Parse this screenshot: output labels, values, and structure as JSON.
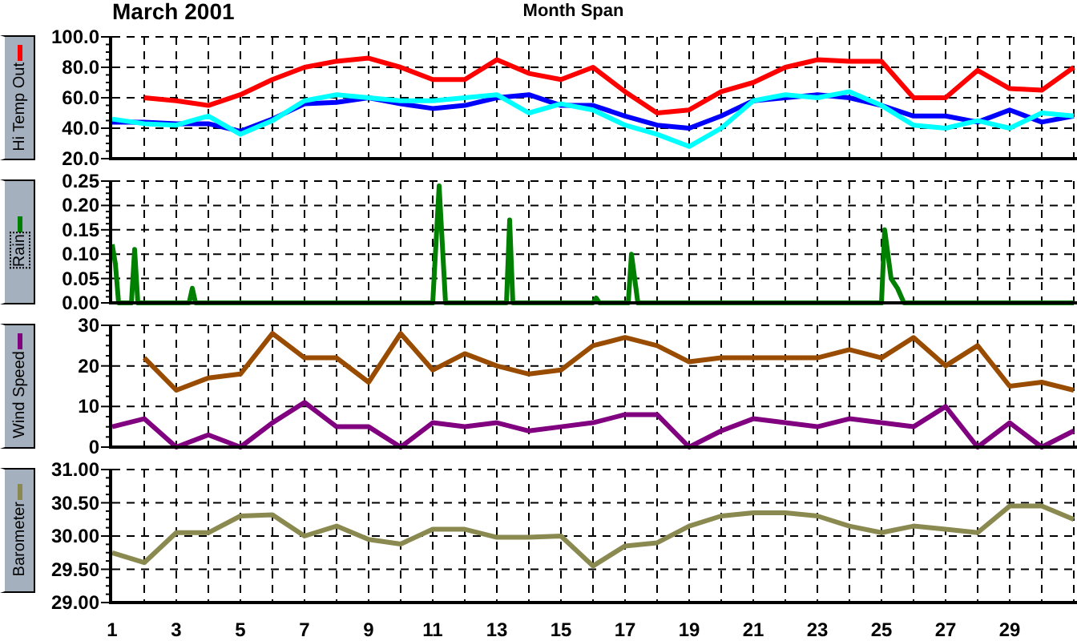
{
  "title": "March 2001",
  "span_label": "Month Span",
  "panels": [
    {
      "button": {
        "label": "Hi Temp Out",
        "color": "#ff0000",
        "focused": false
      },
      "chart_data": {
        "type": "line",
        "grid": true,
        "x": [
          1,
          2,
          3,
          4,
          5,
          6,
          7,
          8,
          9,
          10,
          11,
          12,
          13,
          14,
          15,
          16,
          17,
          18,
          19,
          20,
          21,
          22,
          23,
          24,
          25,
          26,
          27,
          28,
          29,
          30,
          31
        ],
        "xlim": [
          1,
          31
        ],
        "ylim": [
          20,
          100
        ],
        "yticks": [
          {
            "value": 20,
            "label": "20.0"
          },
          {
            "value": 40,
            "label": "40.0"
          },
          {
            "value": 60,
            "label": "60.0"
          },
          {
            "value": 80,
            "label": "80.0"
          },
          {
            "value": 100,
            "label": "100.0"
          }
        ],
        "series": [
          {
            "color": "#ff0000",
            "values": [
              null,
              60,
              58,
              55,
              62,
              72,
              80,
              84,
              86,
              80,
              72,
              72,
              85,
              76,
              72,
              80,
              64,
              50,
              52,
              64,
              70,
              80,
              85,
              84,
              84,
              60,
              60,
              78,
              66,
              65,
              80
            ]
          },
          {
            "color": "#0000ff",
            "values": [
              44,
              44,
              43,
              43,
              38,
              46,
              56,
              57,
              60,
              56,
              53,
              55,
              60,
              62,
              55,
              55,
              48,
              42,
              40,
              48,
              58,
              60,
              62,
              60,
              55,
              48,
              48,
              44,
              52,
              44,
              48
            ]
          },
          {
            "color": "#00ffff",
            "values": [
              46,
              43,
              42,
              48,
              36,
              45,
              58,
              62,
              60,
              58,
              58,
              60,
              62,
              50,
              56,
              52,
              42,
              36,
              28,
              40,
              58,
              62,
              60,
              64,
              55,
              42,
              40,
              45,
              40,
              50,
              48
            ]
          }
        ]
      }
    },
    {
      "button": {
        "label": "Rain",
        "color": "#008000",
        "focused": true
      },
      "chart_data": {
        "type": "line",
        "grid": true,
        "x": [
          1,
          1.1,
          1.2,
          1.6,
          1.7,
          1.8,
          3.4,
          3.5,
          3.6,
          11.0,
          11.2,
          11.4,
          13.3,
          13.4,
          13.5,
          16.0,
          16.1,
          16.2,
          17.1,
          17.2,
          17.4,
          25.0,
          25.1,
          25.3,
          25.5,
          25.7,
          31
        ],
        "xlim": [
          1,
          31
        ],
        "ylim": [
          0,
          0.25
        ],
        "yticks": [
          {
            "value": 0,
            "label": "0.00"
          },
          {
            "value": 0.05,
            "label": "0.05"
          },
          {
            "value": 0.1,
            "label": "0.10"
          },
          {
            "value": 0.15,
            "label": "0.15"
          },
          {
            "value": 0.2,
            "label": "0.20"
          },
          {
            "value": 0.25,
            "label": "0.25"
          }
        ],
        "series": [
          {
            "color": "#008000",
            "values": [
              0.12,
              0.08,
              0,
              0,
              0.11,
              0,
              0,
              0.03,
              0,
              0,
              0.24,
              0,
              0,
              0.17,
              0,
              0,
              0.01,
              0,
              0,
              0.1,
              0,
              0,
              0.15,
              0.05,
              0.03,
              0,
              0
            ]
          }
        ]
      }
    },
    {
      "button": {
        "label": "Wind Speed",
        "color": "#800080",
        "focused": false
      },
      "chart_data": {
        "type": "line",
        "x": [
          1,
          2,
          3,
          4,
          5,
          6,
          7,
          8,
          9,
          10,
          11,
          12,
          13,
          14,
          15,
          16,
          17,
          18,
          19,
          20,
          21,
          22,
          23,
          24,
          25,
          26,
          27,
          28,
          29,
          30,
          31
        ],
        "xlim": [
          1,
          31
        ],
        "ylim": [
          0,
          30
        ],
        "grid": true,
        "yticks": [
          0,
          10,
          20,
          30
        ],
        "series": [
          {
            "color": "#994c00",
            "values": [
              null,
              22,
              14,
              17,
              18,
              28,
              22,
              22,
              16,
              28,
              19,
              23,
              20,
              18,
              19,
              25,
              27,
              25,
              21,
              22,
              22,
              22,
              22,
              24,
              22,
              27,
              20,
              25,
              15,
              16,
              14
            ]
          },
          {
            "color": "#800080",
            "values": [
              5,
              7,
              0,
              3,
              0,
              6,
              11,
              5,
              5,
              0,
              6,
              5,
              6,
              4,
              5,
              6,
              8,
              8,
              0,
              4,
              7,
              6,
              5,
              7,
              6,
              5,
              10,
              0,
              6,
              0,
              4
            ]
          }
        ]
      }
    },
    {
      "button": {
        "label": "Barometer",
        "color": "#8a8a50",
        "focused": false
      },
      "chart_data": {
        "type": "line",
        "x": [
          1,
          2,
          3,
          4,
          5,
          6,
          7,
          8,
          9,
          10,
          11,
          12,
          13,
          14,
          15,
          16,
          17,
          18,
          19,
          20,
          21,
          22,
          23,
          24,
          25,
          26,
          27,
          28,
          29,
          30,
          31
        ],
        "xlim": [
          1,
          31
        ],
        "ylim": [
          29,
          31
        ],
        "grid": true,
        "xticks": [
          1,
          3,
          5,
          7,
          9,
          11,
          13,
          15,
          17,
          19,
          21,
          23,
          25,
          27,
          29
        ],
        "yticks": [
          {
            "value": 29,
            "label": "29.00"
          },
          {
            "value": 29.5,
            "label": "29.50"
          },
          {
            "value": 30,
            "label": "30.00"
          },
          {
            "value": 30.5,
            "label": "30.50"
          },
          {
            "value": 31,
            "label": "31.00"
          }
        ],
        "series": [
          {
            "color": "#8a8a50",
            "values": [
              29.75,
              29.6,
              30.05,
              30.05,
              30.3,
              30.32,
              30.0,
              30.15,
              29.95,
              29.88,
              30.1,
              30.1,
              29.98,
              29.98,
              30.0,
              29.55,
              29.85,
              29.9,
              30.15,
              30.3,
              30.35,
              30.35,
              30.3,
              30.15,
              30.05,
              30.15,
              30.1,
              30.05,
              30.45,
              30.45,
              30.25
            ]
          }
        ]
      }
    }
  ]
}
